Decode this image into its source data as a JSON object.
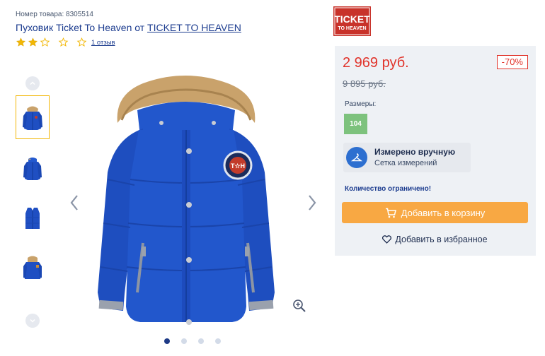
{
  "header": {
    "sku": "Номер товара: 8305514",
    "title_prefix": "Пуховик Ticket To Heaven от ",
    "brand_link": "TICKET TO HEAVEN",
    "rating_value": 2,
    "rating_max": 5,
    "reviews_link": "1 отзыв"
  },
  "logo": {
    "line1": "TICKET",
    "line2": "TO HEAVEN",
    "color": "#c8322a"
  },
  "gallery": {
    "thumbnails": [
      "jacket-hood-front",
      "jacket-front",
      "vest-front",
      "jacket-back"
    ],
    "active_thumbnail": 0,
    "slides": 4,
    "active_slide": 0,
    "jacket_color": "#1f4fc2",
    "patch_text": "T☆H"
  },
  "buy": {
    "price": "2 969 руб.",
    "discount": "-70%",
    "old_price": "9 895 руб.",
    "sizes_label": "Размеры:",
    "sizes": [
      "104"
    ],
    "measure_title": "Измерено вручную",
    "measure_subtitle": "Сетка измерений",
    "limited": "Количество ограничено!",
    "add_to_cart": "Добавить в корзину",
    "add_to_favorites": "Добавить в избранное"
  },
  "colors": {
    "price_red": "#e1342b",
    "cart_orange": "#f8a843",
    "size_green": "#7dc27d",
    "link_blue": "#1c3c8f",
    "star_gold": "#f2b705"
  }
}
